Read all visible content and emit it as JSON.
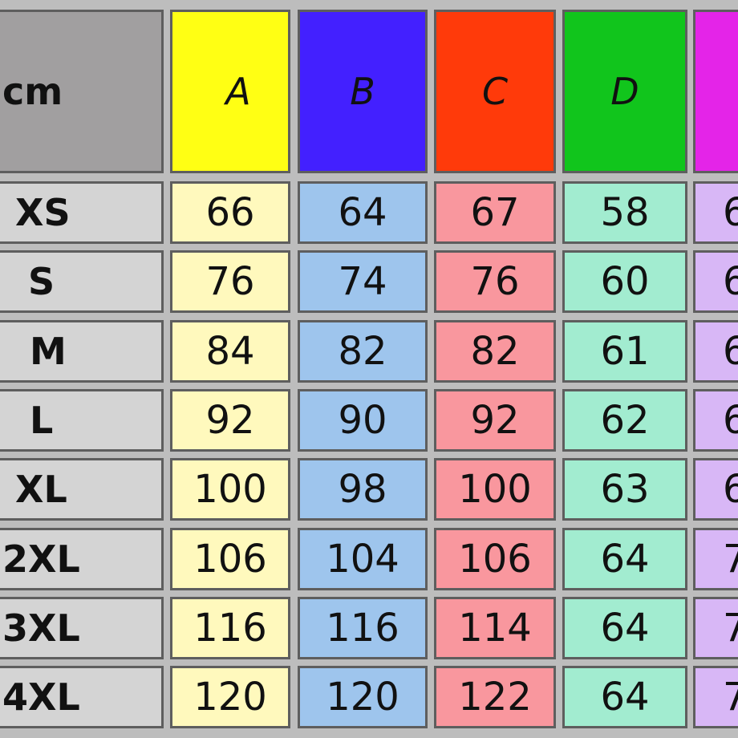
{
  "table": {
    "unit": "cm",
    "columns": [
      {
        "label": "A",
        "header_color": "#ffff14",
        "cell_color": "#fff9bd"
      },
      {
        "label": "B",
        "header_color": "#4320ff",
        "cell_color": "#9ec5ed"
      },
      {
        "label": "C",
        "header_color": "#ff3a0a",
        "cell_color": "#f9979e"
      },
      {
        "label": "D",
        "header_color": "#11c51c",
        "cell_color": "#a2ecd0"
      },
      {
        "label": "",
        "header_color": "#e424e8",
        "cell_color": "#d8b7f6"
      }
    ],
    "rows": [
      {
        "size": "XS",
        "values": [
          "66",
          "64",
          "67",
          "58",
          "6"
        ]
      },
      {
        "size": "S",
        "values": [
          "76",
          "74",
          "76",
          "60",
          "6"
        ]
      },
      {
        "size": "M",
        "values": [
          "84",
          "82",
          "82",
          "61",
          "6"
        ]
      },
      {
        "size": "L",
        "values": [
          "92",
          "90",
          "92",
          "62",
          "6"
        ]
      },
      {
        "size": "XL",
        "values": [
          "100",
          "98",
          "100",
          "63",
          "6"
        ]
      },
      {
        "size": "2XL",
        "values": [
          "106",
          "104",
          "106",
          "64",
          "7"
        ]
      },
      {
        "size": "3XL",
        "values": [
          "116",
          "116",
          "114",
          "64",
          "7"
        ]
      },
      {
        "size": "4XL",
        "values": [
          "120",
          "120",
          "122",
          "64",
          "7"
        ]
      }
    ],
    "colors": {
      "corner": "#a19fa0",
      "size_cell": "#d4d4d4",
      "border": "#5e5e5e",
      "background": "#bdbdbd"
    }
  }
}
